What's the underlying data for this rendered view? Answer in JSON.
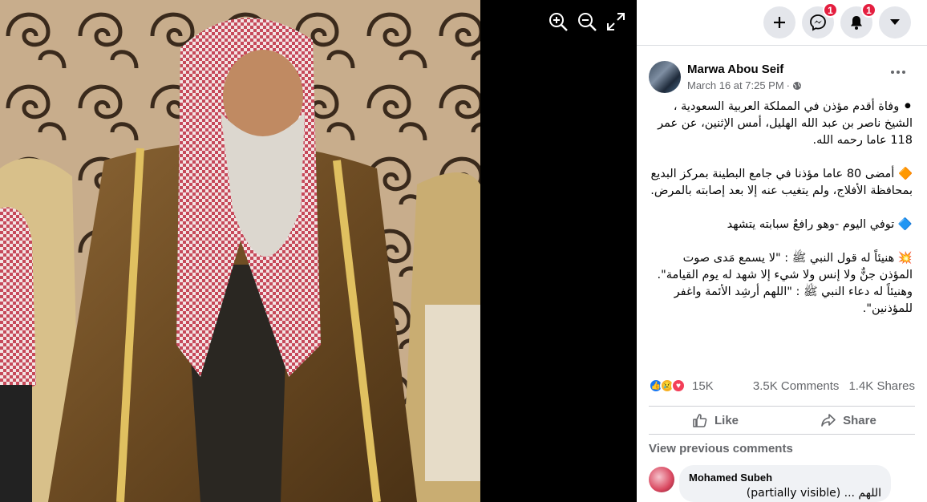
{
  "topbar": {
    "messenger_badge": "1",
    "notifications_badge": "1"
  },
  "post": {
    "author": "Marwa Abou Seif",
    "timestamp": "March 16 at 7:25 PM",
    "separator": "·",
    "paragraphs": [
      "⚫ وفاة أقدم مؤذن في المملكة العربية السعودية ، الشيخ ناصر بن عبد الله الهليل، أمس الإثنين، عن عمر 118 عاما رحمه الله.",
      "🔶 أمضى 80 عاما مؤذنا في جامع البطينة بمركز البديع بمحافظة الأفلاج، ولم يتغيب عنه إلا بعد إصابته بالمرض.",
      "🔷 توفي اليوم -وهو رافعٌ سبابته يتشهد",
      "💥 هنيئاً له قول النبي ﷺ : \"لا يسمع مَدى صوت المؤذن جنٌّ ولا إنس ولا شيء إلا شهد له يوم القيامة\".",
      "وهنيئاً له دعاء النبي ﷺ : \"اللهم أرشِد الأئمة واغفر للمؤذنين\"."
    ],
    "reaction_count": "15K",
    "comments_count": "3.5K Comments",
    "shares_count": "1.4K Shares",
    "like_label": "Like",
    "share_label": "Share",
    "view_previous": "View previous comments"
  },
  "comment": {
    "name": "Mohamed Subeh",
    "text": "اللهم ... (partially visible)"
  },
  "colors": {
    "badge": "#e41e3f",
    "button_bg": "#e4e6eb",
    "secondary_text": "#65676b",
    "like_blue": "#1877f2",
    "love_red": "#f33e58",
    "haha_yellow": "#f7b125"
  }
}
